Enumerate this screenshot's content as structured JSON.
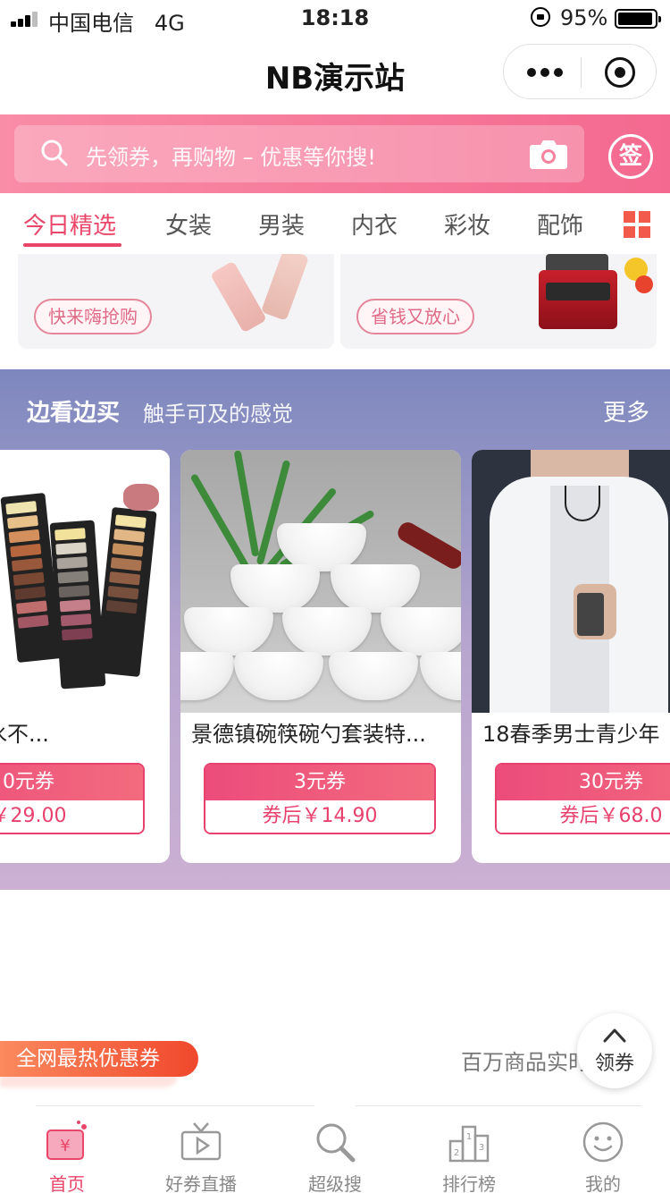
{
  "status_bar": {
    "carrier": "中国电信",
    "network": "4G",
    "time": "18:18",
    "battery": "95%",
    "battery_level": 0.95
  },
  "nav": {
    "title": "NB演示站"
  },
  "search": {
    "placeholder": "先领券，再购物 – 优惠等你搜!",
    "sign_label": "签"
  },
  "tabs": [
    {
      "label": "今日精选",
      "active": true
    },
    {
      "label": "女装"
    },
    {
      "label": "男装"
    },
    {
      "label": "内衣"
    },
    {
      "label": "彩妆"
    },
    {
      "label": "配饰"
    }
  ],
  "promos": [
    {
      "label": "快来嗨抢购"
    },
    {
      "label": "省钱又放心"
    }
  ],
  "browse": {
    "title": "边看边买",
    "subtitle": "触手可及的感觉",
    "more": "更多",
    "products": [
      {
        "name": "眼影盘防水不...",
        "coupon": "0元券",
        "price": "￥29.00"
      },
      {
        "name": "景德镇碗筷碗勺套装特...",
        "coupon": "3元券",
        "price": "券后￥14.90"
      },
      {
        "name": "18春季男士青少年",
        "coupon": "30元券",
        "price": "券后￥68.0"
      }
    ]
  },
  "hot_banner": "全网最热优惠券",
  "marquee": "百万商品实时更新",
  "float_button": "领券",
  "tabbar": [
    {
      "label": "首页",
      "icon": "coupon-ticket-icon",
      "active": true
    },
    {
      "label": "好券直播",
      "icon": "tv-play-icon"
    },
    {
      "label": "超级搜",
      "icon": "magnifier-icon"
    },
    {
      "label": "排行榜",
      "icon": "podium-icon"
    },
    {
      "label": "我的",
      "icon": "smiley-face-icon"
    }
  ],
  "colors": {
    "accent": "#e9466a",
    "header_gradient": [
      "#f98ca7",
      "#f4698f"
    ],
    "browse_gradient": [
      "#7d88be",
      "#cbb0d2"
    ],
    "hot_banner": "#f0482c"
  }
}
